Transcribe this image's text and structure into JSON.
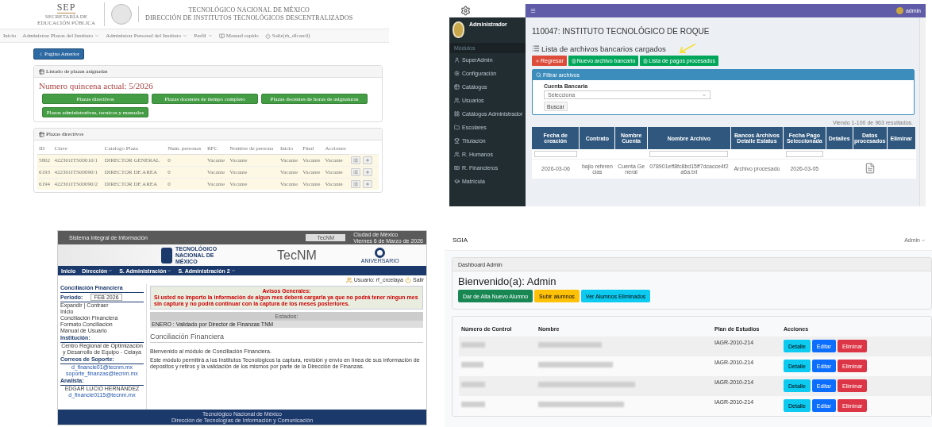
{
  "plazas_screen": {
    "logo_text": "SEP",
    "logo_subtext": "SECRETARÍA DE EDUCACIÓN PÚBLICA",
    "title_lines": [
      "TECNOLÓGICO NACIONAL DE MÉXICO",
      "DIRECCIÓN DE INSTITUTOS TECNOLÓGICOS DESCENTRALIZADOS"
    ],
    "nav": [
      {
        "label": "Inicio",
        "kind": "link"
      },
      {
        "label": "Administrar Plazas del Instituto",
        "kind": "dropdown"
      },
      {
        "label": "Administrar Personal del Instituto",
        "kind": "dropdown"
      },
      {
        "label": "Perfil",
        "kind": "dropdown"
      },
      {
        "label": "Manual rapido",
        "kind": "book"
      },
      {
        "label": "Salir(rh_dfcarril)",
        "kind": "power"
      }
    ],
    "back_button": "Pagina Anterior",
    "assigned_panel": {
      "title": "Listado de plazas asignadas",
      "quincena": "Numero quincena actual: 5/2026",
      "buttons": [
        "Plazas directivos",
        "Plazas docentes de tiempo completo",
        "Plazas docentes de horas de asignaturas",
        "Plazas administrativas, tecnicos y manuales"
      ]
    },
    "table_panel": {
      "title": "Plazas directivos",
      "columns": [
        "ID",
        "Clave",
        "Catalogo Plaza",
        "Num. personas",
        "RFC",
        "Nombre de persona",
        "Inicio",
        "Final",
        "Acciones"
      ],
      "rows": [
        {
          "cells": [
            "5802",
            "422301ITS00010/1",
            "DIRECTOR GENERAL",
            "0",
            "Vacante",
            "Vacante",
            "Vacante",
            "Vacante",
            "Vacante"
          ]
        },
        {
          "cells": [
            "6193",
            "422301ITS00090/1",
            "DIRECTOR DE AREA",
            "0",
            "Vacante",
            "Vacante",
            "Vacante",
            "Vacante",
            "Vacante"
          ]
        },
        {
          "cells": [
            "6194",
            "422301ITS00090/2",
            "DIRECTOR DE AREA",
            "0",
            "Vacante",
            "Vacante",
            "Vacante",
            "Vacante",
            "Vacante"
          ]
        }
      ]
    }
  },
  "bancos_screen": {
    "topbar_user": "admin",
    "sidebar": {
      "user": "Administrador",
      "section": "Módulos",
      "items": [
        "SuperAdmin",
        "Configuración",
        "Catálogos",
        "Usuarios",
        "Catálogos Administrador",
        "Escolares",
        "Titulación",
        "R. Humanos",
        "R. Financieros",
        "Matrícula"
      ]
    },
    "page_title": "110047: INSTITUTO TECNOLÓGICO DE ROQUE",
    "list_title": "Lista de archivos bancarios cargados",
    "buttons": [
      {
        "label": "Regresar",
        "kind": "danger"
      },
      {
        "label": "Nuevo archivo bancario",
        "kind": "success"
      },
      {
        "label": "Lista de pagos procesados",
        "kind": "success"
      }
    ],
    "filter": {
      "title": "Filtrar archivos",
      "label": "Cuenta Bancaria",
      "select_value": "Selecciona",
      "button": "Buscar"
    },
    "results": "Viendo 1-100 de 963 resultados.",
    "table": {
      "columns": [
        "Fecha de creación",
        "Contrato",
        "Nombre Cuenta",
        "Nombre Archivo",
        "Bancos Archivos Detalle Estatus",
        "Fecha Pago Seleccionada",
        "Detalles",
        "Datos procesados",
        "Eliminar"
      ],
      "rows": [
        {
          "cells": [
            "2026-03-06",
            "bajio referencias",
            "Cuenta General",
            "078901eff8fc8bd15ff7dcacce4f2a6a.txt",
            "Archivo procesado",
            "2026-03-05"
          ]
        }
      ]
    }
  },
  "conciliacion_screen": {
    "system_name": "Sistema Integral de Información",
    "tab": "TecNM",
    "date_lines": [
      "Ciudad de México",
      "Viernes 6 de Marzo de 2026"
    ],
    "logo_text": "TECNOLÓGICO NACIONAL DE MÉXICO",
    "brand": "TecNM",
    "anniversary": "ANIVERSARIO",
    "nav": [
      "Inicio",
      "Dirección",
      "S. Administración",
      "S. Administración 2"
    ],
    "user": "Usuario: rf_crcelaya",
    "logout": "Salir",
    "sidebar": {
      "title": "Conciliación Financiera",
      "period_label": "Periodo:",
      "period_value": "FEB 2026",
      "expand": "Expandir | Contraer",
      "tree": [
        "Inicio",
        "Conciliación Financiera",
        "Formato Conciliacion",
        "Manual de Usuario"
      ],
      "sections": [
        {
          "title": "Institución:",
          "lines": [
            "Centro Regional de Optimización y Desarrollo de Equipo - Celaya"
          ]
        },
        {
          "title": "Correos de Soporte:",
          "lines": [
            "d_financie01@tecnm.mx",
            "soporte_finanzas@tecnm.mx"
          ]
        },
        {
          "title": "Analista:",
          "lines": [
            "EDGAR LUCIO HERNÁNDEZ",
            "d_financie0115@tecnm.mx"
          ]
        }
      ]
    },
    "notice": {
      "title": "Avisos Generales:",
      "text": "Si usted no importo la información de algun mes deberá cargarla ya que no podrá tener ningun mes sin captura y no podrá continuar con la captura de los meses posteriores."
    },
    "states": {
      "title": "Estados:",
      "line": "ENERO  : Validado por Director de Finanzas TNM"
    },
    "heading": "Conciliación Financiera",
    "paragraphs": [
      "Bienvenido al módulo de Conciliación Financiera.",
      "Este módulo permitirá a los Institutos Tecnológicos la captura, revisión y envío en línea de sus información de depositos y retiros y la validación de los mismos por parte de la Dirección de Finanzas."
    ],
    "footer": [
      "Tecnológico Nacional de México",
      "Dirección de Tecnologías de Información y Comunicación"
    ]
  },
  "sgia_screen": {
    "brand": "SGIA",
    "user": "Admin",
    "breadcrumb": "Dashboard Admin",
    "welcome": "Bienvenido(a): Admin",
    "buttons": [
      {
        "label": "Dar de Alta Nuevo Alumno",
        "kind": "success"
      },
      {
        "label": "Subir alumnos",
        "kind": "warning"
      },
      {
        "label": "Ver Alumnos Eliminados",
        "kind": "info"
      }
    ],
    "columns": [
      "Número de Control",
      "Nombre",
      "Plan de Estudios",
      "Acciones"
    ],
    "rows": [
      {
        "plan": "IAGR-2010-214",
        "actions": [
          {
            "label": "Detalle",
            "kind": "info"
          },
          {
            "label": "Editar",
            "kind": "primary"
          },
          {
            "label": "Eliminar",
            "kind": "danger"
          }
        ]
      },
      {
        "plan": "IAGR-2010-214",
        "actions": [
          {
            "label": "Detalle",
            "kind": "info"
          },
          {
            "label": "Editar",
            "kind": "primary"
          },
          {
            "label": "Eliminar",
            "kind": "danger"
          }
        ]
      },
      {
        "plan": "IAGR-2010-214",
        "actions": [
          {
            "label": "Detalle",
            "kind": "info"
          },
          {
            "label": "Editar",
            "kind": "primary"
          },
          {
            "label": "Eliminar",
            "kind": "danger"
          }
        ]
      },
      {
        "plan": "IAGR-2010-214",
        "actions": [
          {
            "label": "Detalle",
            "kind": "info"
          },
          {
            "label": "Editar",
            "kind": "primary"
          },
          {
            "label": "Eliminar",
            "kind": "danger"
          }
        ]
      }
    ]
  }
}
